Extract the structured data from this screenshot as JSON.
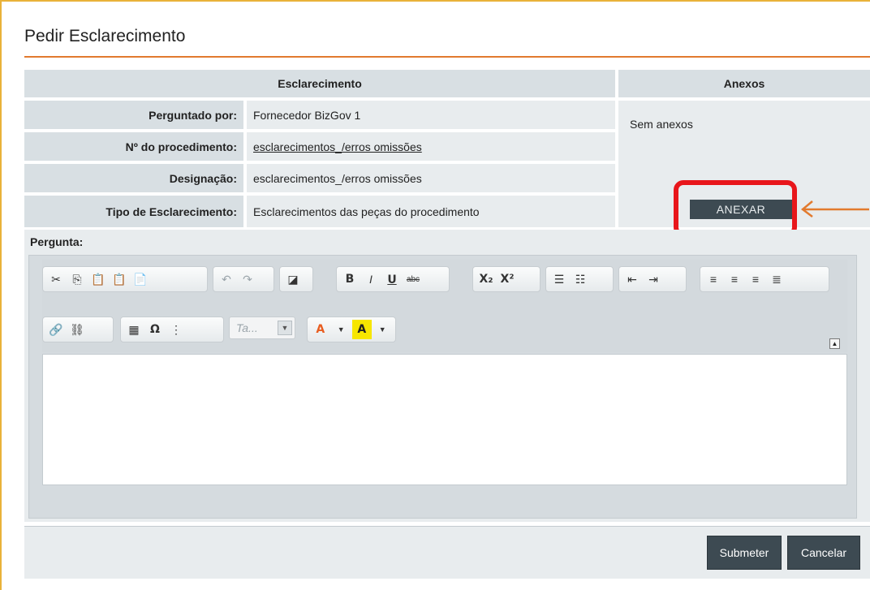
{
  "page": {
    "title": "Pedir Esclarecimento"
  },
  "esclarecimento": {
    "header": "Esclarecimento",
    "rows": [
      {
        "label": "Perguntado por:",
        "value": "Fornecedor BizGov 1"
      },
      {
        "label": "Nº do procedimento:",
        "value": "esclarecimentos_/erros omissões"
      },
      {
        "label": "Designação:",
        "value": "esclarecimentos_/erros omissões"
      },
      {
        "label": "Tipo de Esclarecimento:",
        "value": "Esclarecimentos das peças do procedimento"
      }
    ]
  },
  "anexos": {
    "header": "Anexos",
    "empty_text": "Sem anexos",
    "attach_button": "ANEXAR"
  },
  "pergunta": {
    "label": "Pergunta:",
    "font_combo": "Ta...",
    "toolbar_icons": [
      "cut-icon",
      "copy-icon",
      "paste-icon",
      "paste-text-icon",
      "paste-word-icon",
      "undo-icon",
      "redo-icon",
      "eraser-icon",
      "bold-icon",
      "italic-icon",
      "underline-icon",
      "strikethrough-icon",
      "subscript-icon",
      "superscript-icon",
      "numbered-list-icon",
      "bullet-list-icon",
      "outdent-icon",
      "indent-icon",
      "align-left-icon",
      "align-center-icon",
      "align-right-icon",
      "justify-icon",
      "link-icon",
      "unlink-icon",
      "table-icon",
      "special-char-icon",
      "page-break-icon",
      "text-color-icon",
      "background-color-icon"
    ]
  },
  "footer": {
    "submit": "Submeter",
    "cancel": "Cancelar"
  },
  "colors": {
    "accent_orange": "#e27a2e",
    "annotation_red": "#e8161b",
    "button_dark": "#3d4a52"
  }
}
